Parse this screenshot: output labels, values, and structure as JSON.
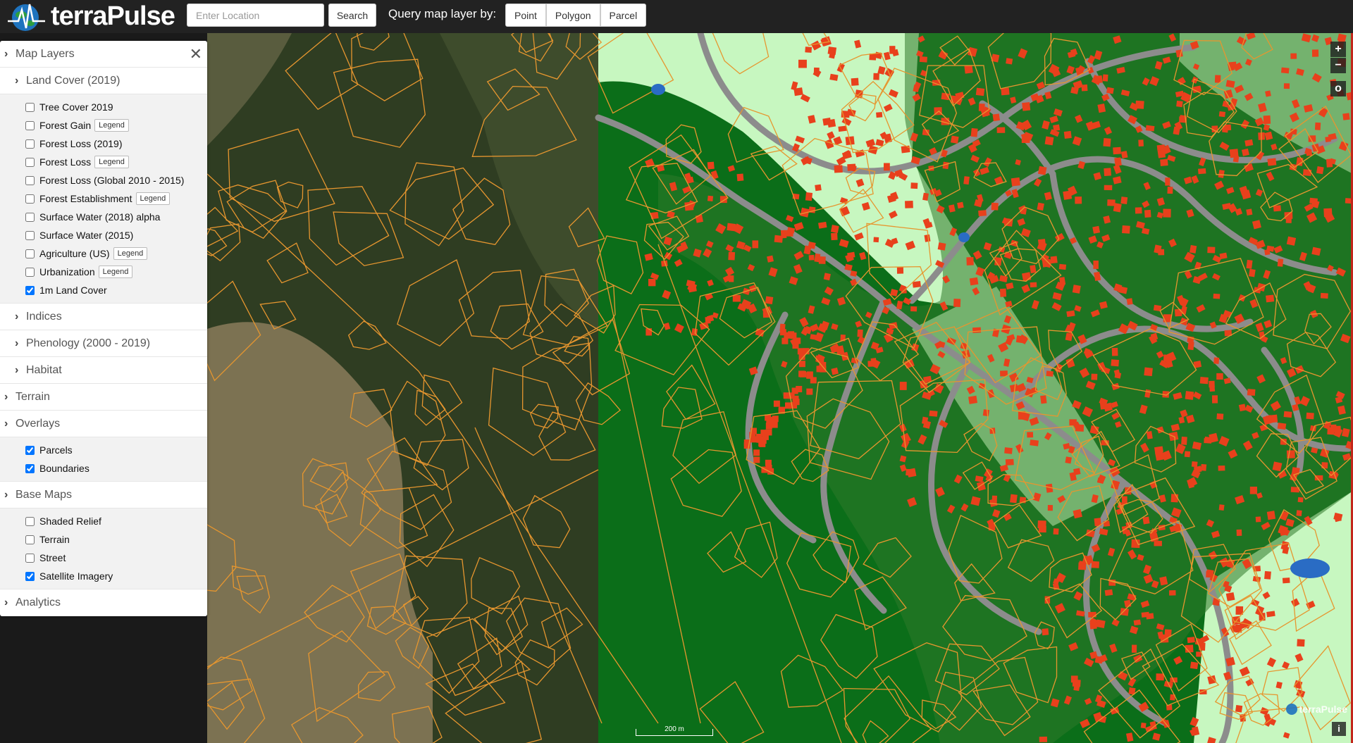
{
  "brand": {
    "name": "terraPulse"
  },
  "search": {
    "placeholder": "Enter Location",
    "button_label": "Search"
  },
  "query": {
    "label": "Query map layer by:",
    "options": [
      "Point",
      "Polygon",
      "Parcel"
    ]
  },
  "sidebar": {
    "title": "Map Layers",
    "close_icon": "close-icon",
    "land_cover": {
      "title": "Land Cover (2019)",
      "items": [
        {
          "label": "Tree Cover 2019",
          "checked": false
        },
        {
          "label": "Forest Gain",
          "legend": "Legend",
          "checked": false
        },
        {
          "label": "Forest Loss (2019)",
          "checked": false
        },
        {
          "label": "Forest Loss",
          "legend": "Legend",
          "checked": false
        },
        {
          "label": "Forest Loss (Global 2010 - 2015)",
          "checked": false
        },
        {
          "label": "Forest Establishment",
          "legend": "Legend",
          "checked": false
        },
        {
          "label": "Surface Water (2018) alpha",
          "checked": false
        },
        {
          "label": "Surface Water (2015)",
          "checked": false
        },
        {
          "label": "Agriculture (US)",
          "legend": "Legend",
          "checked": false
        },
        {
          "label": "Urbanization",
          "legend": "Legend",
          "checked": false
        },
        {
          "label": "1m Land Cover",
          "checked": true
        }
      ]
    },
    "indices": {
      "title": "Indices"
    },
    "phenology": {
      "title": "Phenology (2000 - 2019)"
    },
    "habitat": {
      "title": "Habitat"
    },
    "terrain": {
      "title": "Terrain"
    },
    "overlays": {
      "title": "Overlays",
      "items": [
        {
          "label": "Parcels",
          "checked": true
        },
        {
          "label": "Boundaries",
          "checked": true
        }
      ]
    },
    "base_maps": {
      "title": "Base Maps",
      "items": [
        {
          "label": "Shaded Relief",
          "checked": false
        },
        {
          "label": "Terrain",
          "checked": false
        },
        {
          "label": "Street",
          "checked": false
        },
        {
          "label": "Satellite Imagery",
          "checked": true
        }
      ]
    },
    "analytics": {
      "title": "Analytics"
    }
  },
  "map": {
    "zoom_in": "+",
    "zoom_out": "−",
    "locate": "o",
    "scale_label": "200 m",
    "watermark": "terraPulse",
    "info": "i",
    "colors": {
      "satellite_forest": "#2f3d22",
      "satellite_dry": "#8a7b5a",
      "forest": "#0b6e19",
      "grass": "#c7f7c0",
      "roads": "#8c8c8c",
      "buildings": "#e8401c",
      "parcels": "#e6962f",
      "water": "#2a6cc4"
    }
  }
}
